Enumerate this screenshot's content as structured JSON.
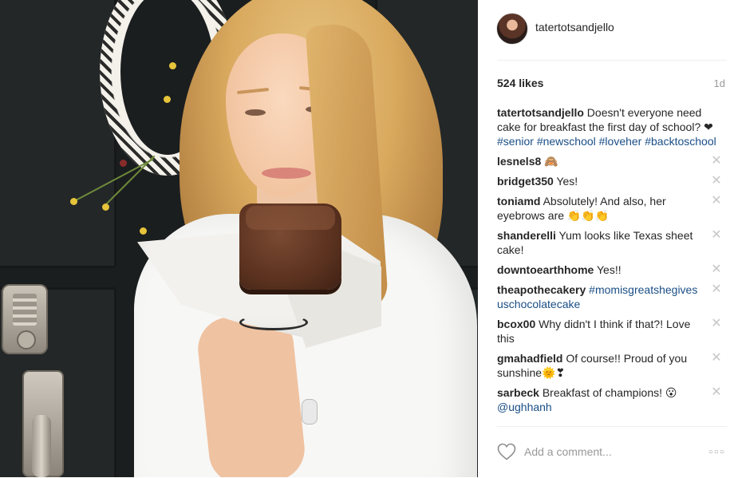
{
  "post": {
    "username": "tatertotsandjello",
    "likes": "524 likes",
    "time": "1d",
    "caption": {
      "user": "tatertotsandjello",
      "text": " Doesn't everyone need cake for breakfast the first day of school? ❤ ",
      "hashtags": [
        "#senior",
        "#newschool",
        "#loveher",
        "#backtoschool"
      ]
    }
  },
  "comments": [
    {
      "user": "lesnels8",
      "text": " 🙈"
    },
    {
      "user": "bridget350",
      "text": " Yes!"
    },
    {
      "user": "toniamd",
      "text": " Absolutely! And also, her eyebrows are 👏👏👏"
    },
    {
      "user": "shanderelli",
      "text": " Yum looks like Texas sheet cake!"
    },
    {
      "user": "downtoearthhome",
      "text": " Yes!!"
    },
    {
      "user": "theapothecakery",
      "text": " ",
      "tag": "#momisgreatshegivesuschocolatecake"
    },
    {
      "user": "bcox00",
      "text": " Why didn't I think if that?! Love this"
    },
    {
      "user": "gmahadfield",
      "text": " Of course!! Proud of you sunshine🌞❣"
    },
    {
      "user": "sarbeck",
      "text": " Breakfast of champions! 😮 ",
      "tag": "@ughhanh"
    }
  ],
  "ui": {
    "delete_glyph": "✕",
    "add_comment_placeholder": "Add a comment...",
    "more_glyph": "○○○"
  },
  "icons": {
    "like": "heart-outline-icon",
    "delete": "close-icon",
    "more": "more-options-icon"
  },
  "colors": {
    "hashtag": "#1a4e86",
    "muted": "#999999",
    "divider": "#efefef"
  }
}
